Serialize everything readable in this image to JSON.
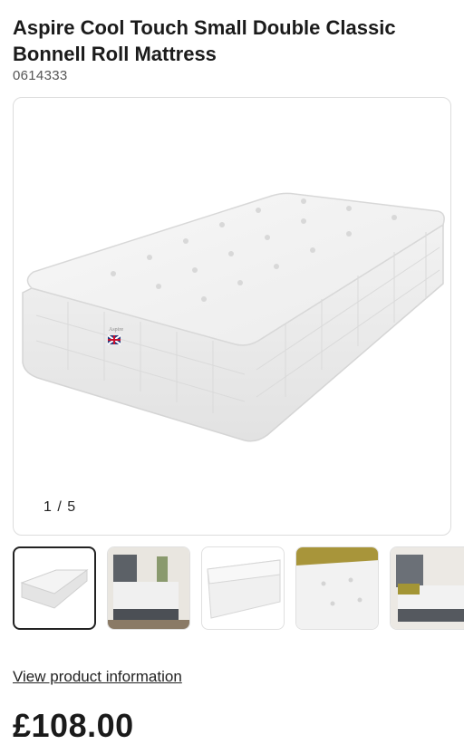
{
  "product": {
    "title": "Aspire Cool Touch Small Double Classic Bonnell Roll Mattress",
    "sku": "0614333",
    "price": "£108.00"
  },
  "gallery": {
    "counter": "1 / 5",
    "thumbnails": [
      {
        "label": "mattress-angled-view",
        "active": true
      },
      {
        "label": "bedroom-grey-headboard"
      },
      {
        "label": "mattress-corner-closeup"
      },
      {
        "label": "mattress-surface-closeup"
      },
      {
        "label": "bedroom-side-view"
      }
    ]
  },
  "links": {
    "view_product_information": "View product information"
  },
  "colors": {
    "text": "#1b1b1b",
    "border": "#dcdcdc",
    "active_border": "#222222"
  }
}
